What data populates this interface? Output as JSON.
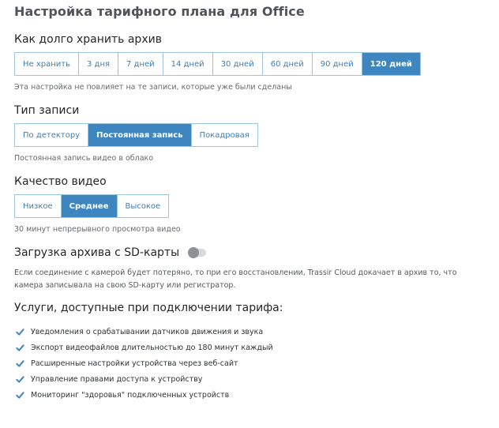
{
  "page": {
    "title": "Настройка тарифного плана для Office"
  },
  "archive": {
    "title": "Как долго хранить архив",
    "options": [
      "Не хранить",
      "3 дня",
      "7 дней",
      "14 дней",
      "30 дней",
      "60 дней",
      "90 дней",
      "120 дней"
    ],
    "selected": "120 дней",
    "hint": "Эта настройка не повлияет на те записи, которые уже были сделаны"
  },
  "record_type": {
    "title": "Тип записи",
    "options": [
      "По детектору",
      "Постоянная запись",
      "Покадровая"
    ],
    "selected": "Постоянная запись",
    "hint": "Постоянная запись видео в облако"
  },
  "quality": {
    "title": "Качество видео",
    "options": [
      "Низкое",
      "Среднее",
      "Высокое"
    ],
    "selected": "Среднее",
    "hint": "30 минут непрерывного просмотра видео"
  },
  "sd_card": {
    "title": "Загрузка архива с SD-карты",
    "enabled": false,
    "description_line1": "Если соединение с камерой будет потеряно, то при его восстановлении, Trassir Cloud докачает в архив то, что",
    "description_line2": "камера записывала на свою SD-карту или регистратор."
  },
  "features": {
    "title": "Услуги, доступные при подключении тарифа:",
    "items": [
      "Уведомления о срабатывании датчиков движения и звука",
      "Экспорт видеофайлов длительностью до 180 минут каждый",
      "Расширенные настройки устройства через веб-сайт",
      "Управление правами доступа к устройству",
      "Мониторинг \"здоровья\" подключенных устройств"
    ]
  },
  "colors": {
    "accent": "#3e86bf",
    "border": "#9fc4de",
    "check": "#3e86bf"
  }
}
